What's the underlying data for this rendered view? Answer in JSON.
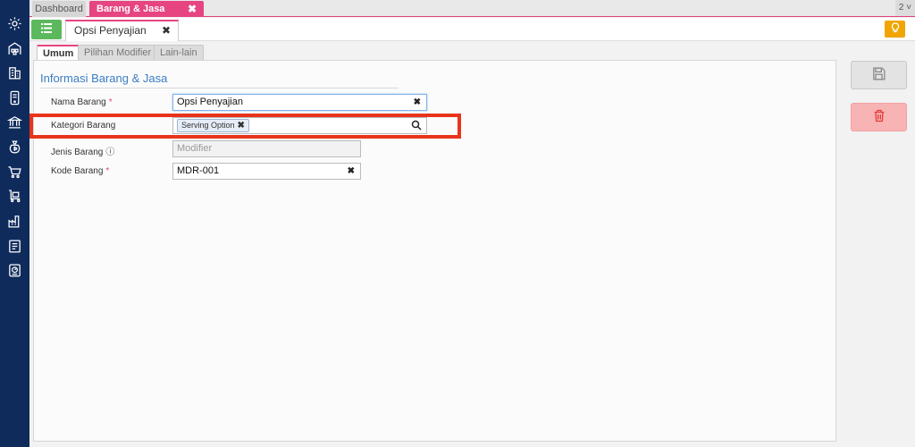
{
  "top_tabs": {
    "dashboard": "Dashboard",
    "active": "Barang & Jasa",
    "close": "✖",
    "count": "2 ˅"
  },
  "doc_tab": {
    "label": "Opsi Penyajian",
    "close": "✖"
  },
  "sub_tabs": [
    "Umum",
    "Pilihan Modifier",
    "Lain-lain"
  ],
  "section": {
    "title": "Informasi Barang & Jasa"
  },
  "fields": {
    "nama_barang": {
      "label": "Nama Barang",
      "required": "*",
      "value": "Opsi Penyajian",
      "clear": "✖"
    },
    "kategori_barang": {
      "label": "Kategori Barang",
      "chip": "Serving Option",
      "chip_remove": "✖"
    },
    "jenis_barang": {
      "label": "Jenis Barang",
      "info": "ⓘ",
      "value": "Modifier"
    },
    "kode_barang": {
      "label": "Kode Barang",
      "required": "*",
      "value": "MDR-001",
      "clear": "✖"
    }
  },
  "colors": {
    "sidebar": "#0f2b5b",
    "accent": "#e64582",
    "highlight": "#e8341c",
    "link": "#3b7dc4"
  },
  "sidebar_icons": [
    "gear-icon",
    "warehouse-icon",
    "building-icon",
    "phone-icon",
    "bank-icon",
    "money-bag-icon",
    "cart-icon",
    "delivery-cart-icon",
    "factory-icon",
    "report-icon",
    "dashboard-icon"
  ]
}
